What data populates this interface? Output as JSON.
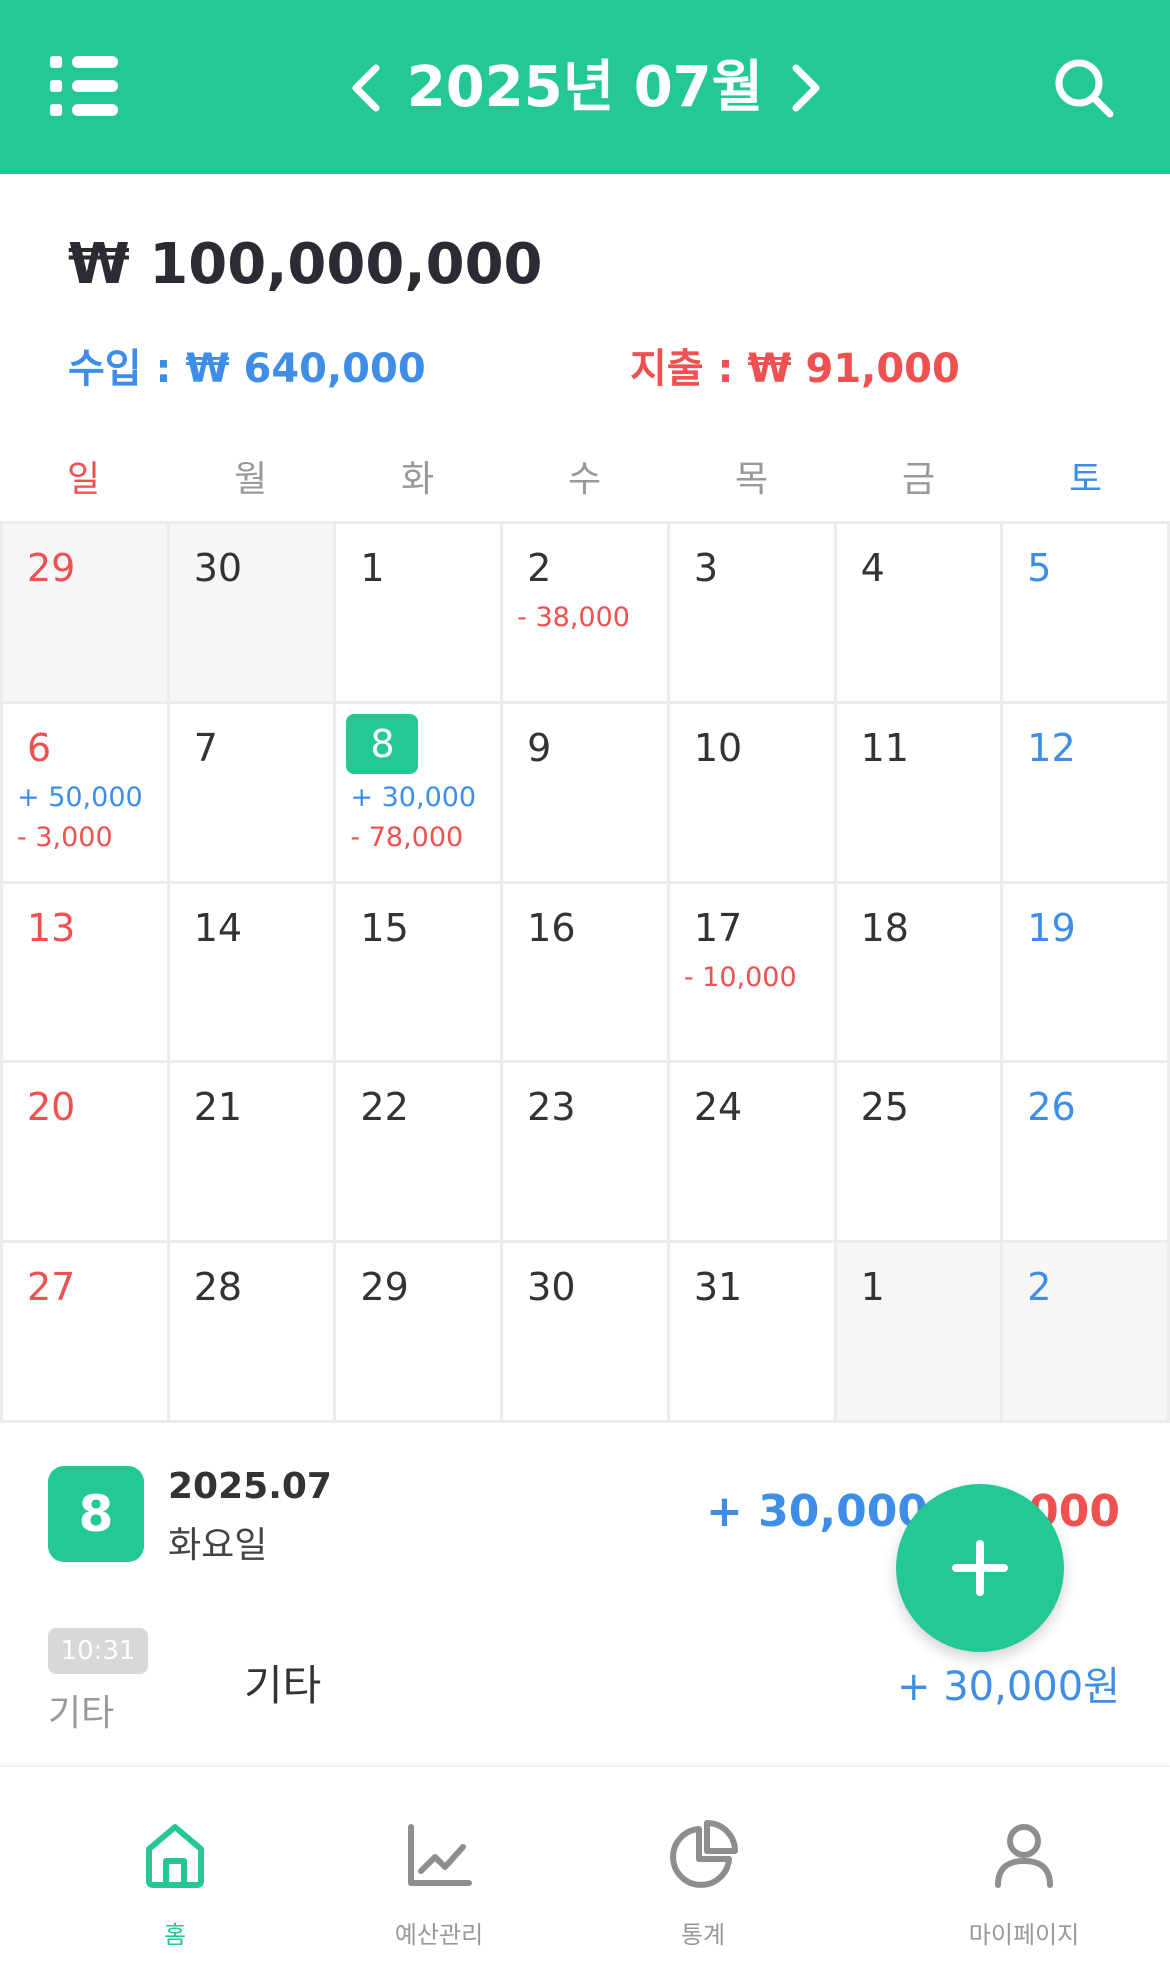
{
  "header": {
    "title": "2025년 07월",
    "bg_color": "#24c896"
  },
  "summary": {
    "balance": "₩ 100,000,000",
    "income": "수입 : ₩ 640,000",
    "expense": "지출 : ₩ 91,000",
    "income_color": "#3e8ee8",
    "expense_color": "#ef5050"
  },
  "weekdays": [
    "일",
    "월",
    "화",
    "수",
    "목",
    "금",
    "토"
  ],
  "calendar": {
    "weeks": [
      [
        {
          "day": "29",
          "other": true
        },
        {
          "day": "30",
          "other": true
        },
        {
          "day": "1"
        },
        {
          "day": "2",
          "expense": "- 38,000"
        },
        {
          "day": "3"
        },
        {
          "day": "4"
        },
        {
          "day": "5"
        }
      ],
      [
        {
          "day": "6",
          "income": "+ 50,000",
          "expense": "- 3,000"
        },
        {
          "day": "7"
        },
        {
          "day": "8",
          "today": true,
          "income": "+ 30,000",
          "expense": "- 78,000"
        },
        {
          "day": "9"
        },
        {
          "day": "10"
        },
        {
          "day": "11"
        },
        {
          "day": "12"
        }
      ],
      [
        {
          "day": "13"
        },
        {
          "day": "14"
        },
        {
          "day": "15"
        },
        {
          "day": "16"
        },
        {
          "day": "17",
          "expense": "- 10,000"
        },
        {
          "day": "18"
        },
        {
          "day": "19"
        }
      ],
      [
        {
          "day": "20"
        },
        {
          "day": "21"
        },
        {
          "day": "22"
        },
        {
          "day": "23"
        },
        {
          "day": "24"
        },
        {
          "day": "25"
        },
        {
          "day": "26"
        }
      ],
      [
        {
          "day": "27"
        },
        {
          "day": "28"
        },
        {
          "day": "29"
        },
        {
          "day": "30"
        },
        {
          "day": "31"
        },
        {
          "day": "1",
          "other": true
        },
        {
          "day": "2",
          "other": true
        }
      ]
    ]
  },
  "selected_day": {
    "day": "8",
    "date": "2025.07",
    "weekday": "화요일",
    "income": "+ 30,000",
    "expense": "000"
  },
  "transactions": [
    {
      "time": "10:31",
      "category": "기타",
      "memo": "기타",
      "amount": "+ 30,000원"
    }
  ],
  "fab": {
    "icon": "plus-icon"
  },
  "bottom_nav": {
    "items": [
      {
        "label": "홈",
        "icon": "home-icon",
        "active": true
      },
      {
        "label": "예산관리",
        "icon": "line-chart-icon",
        "active": false
      },
      {
        "label": "통계",
        "icon": "pie-chart-icon",
        "active": false
      },
      {
        "label": "마이페이지",
        "icon": "user-icon",
        "active": false
      }
    ],
    "active_color": "#24c896",
    "inactive_color": "#999999"
  }
}
